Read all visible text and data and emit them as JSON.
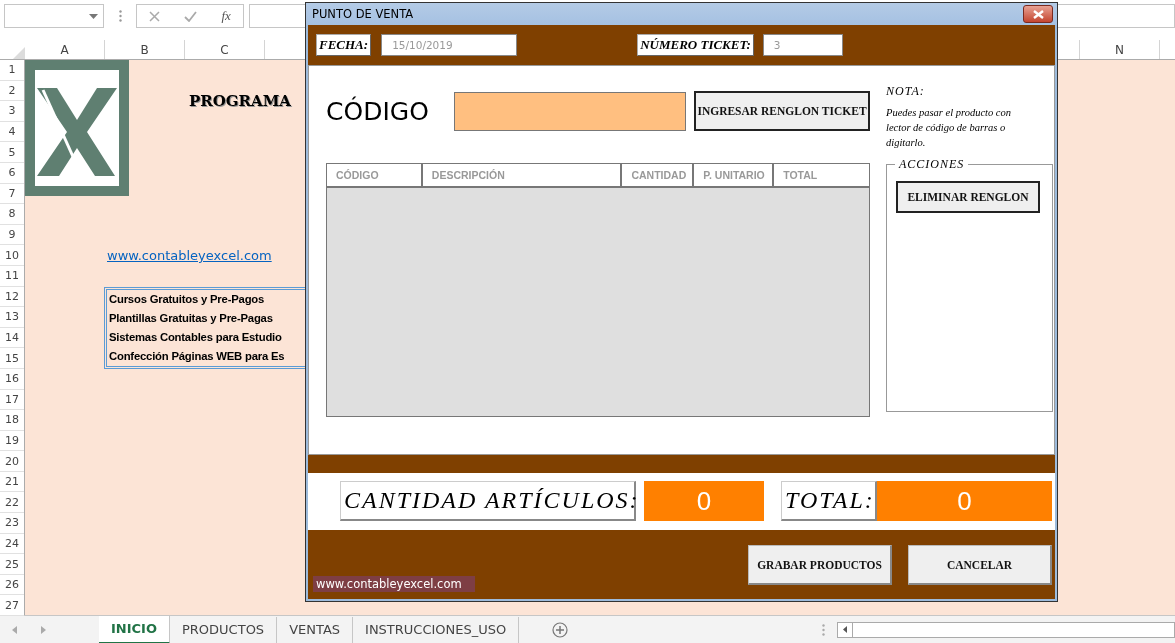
{
  "formula_bar": {
    "function_label": "fx"
  },
  "columns": [
    {
      "label": "A"
    },
    {
      "label": "B"
    },
    {
      "label": "C"
    },
    {
      "label": "N"
    }
  ],
  "rows": [
    "1",
    "2",
    "3",
    "4",
    "5",
    "6",
    "7",
    "8",
    "9",
    "10",
    "11",
    "12",
    "13",
    "14",
    "15",
    "16",
    "17",
    "18",
    "19",
    "20",
    "21",
    "22",
    "23",
    "24",
    "25",
    "26",
    "27"
  ],
  "sheet": {
    "title": "PROGRAMA",
    "link": "www.contableyexcel.com",
    "list": [
      "Cursos Gratuitos y Pre-Pagos",
      "Plantillas Gratuitas y Pre-Pagas",
      "Sistemas Contables para Estudio",
      "Confección Páginas WEB para Es"
    ]
  },
  "sheet_tabs": [
    {
      "label": "INICIO",
      "selected": true
    },
    {
      "label": "PRODUCTOS",
      "selected": false
    },
    {
      "label": "VENTAS",
      "selected": false
    },
    {
      "label": "INSTRUCCIONES_USO",
      "selected": false
    }
  ],
  "dialog": {
    "title": "PUNTO DE VENTA",
    "date_label": "FECHA:",
    "date_value": "15/10/2019",
    "ticket_label": "NÚMERO TICKET:",
    "ticket_value": "3",
    "code_label": "CÓDIGO",
    "add_button": "INGRESAR RENGLON TICKET",
    "note_title": "NOTA:",
    "note_text": "Puedes pasar el producto con lector de código de barras o digitarlo.",
    "table": {
      "columns": [
        "CÓDIGO",
        "DESCRIPCIÓN",
        "CANTIDAD",
        "P. UNITARIO",
        "TOTAL"
      ]
    },
    "actions": {
      "legend": "ACCIONES",
      "buttons": [
        "ELIMINAR RENGLON"
      ]
    },
    "count_label": "CANTIDAD ARTÍCULOS:",
    "count_value": "0",
    "total_label": "TOTAL:",
    "total_value": "0",
    "footer_link": "www.contableyexcel.com",
    "buttons": [
      "GRABAR PRODUCTOS",
      "CANCELAR"
    ]
  }
}
